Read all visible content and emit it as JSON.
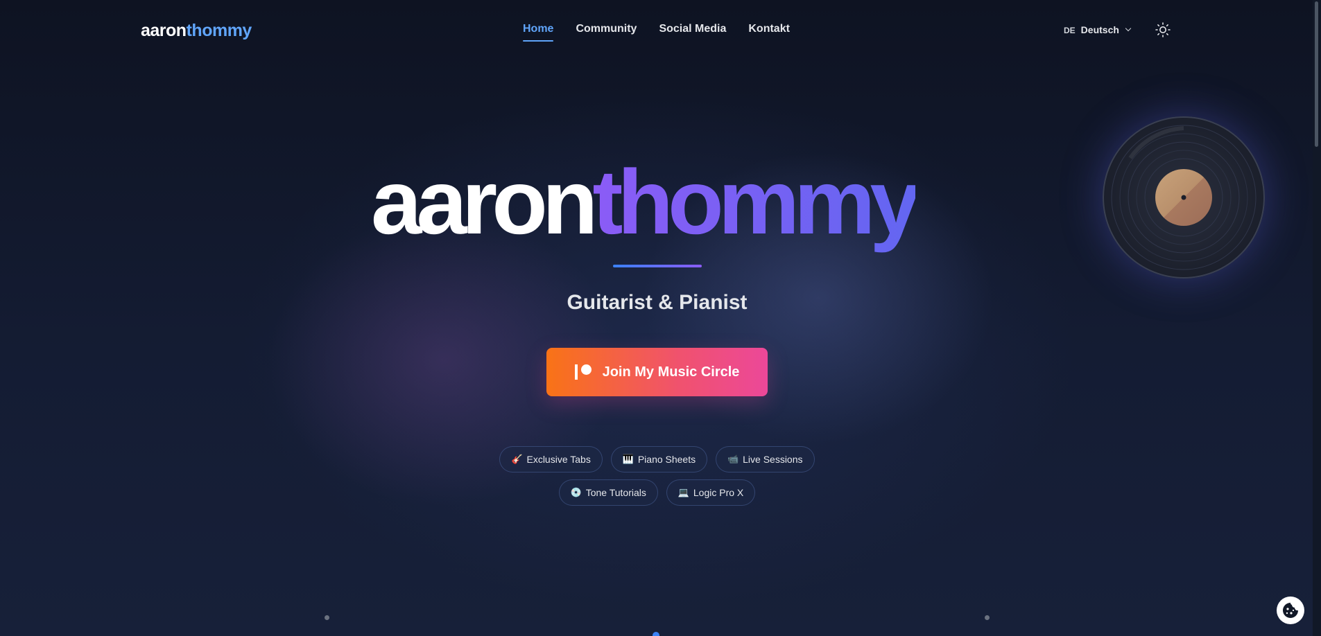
{
  "nav": {
    "logo_part1": "aaron",
    "logo_part2": "thommy",
    "links": [
      {
        "label": "Home",
        "active": true
      },
      {
        "label": "Community",
        "active": false
      },
      {
        "label": "Social Media",
        "active": false
      },
      {
        "label": "Kontakt",
        "active": false
      }
    ],
    "language": {
      "code": "DE",
      "name": "Deutsch"
    },
    "theme_icon": "sun-icon"
  },
  "hero": {
    "title_part1": "aaron",
    "title_part2": "thommy",
    "subtitle": "Guitarist & Pianist",
    "cta_label": "Join My Music Circle",
    "cta_icon": "patreon-icon"
  },
  "chips": [
    {
      "icon": "guitar-icon",
      "glyph": "🎸",
      "label": "Exclusive Tabs"
    },
    {
      "icon": "piano-icon",
      "glyph": "🎹",
      "label": "Piano Sheets"
    },
    {
      "icon": "camera-icon",
      "glyph": "📹",
      "label": "Live Sessions"
    },
    {
      "icon": "disc-icon",
      "glyph": "💿",
      "label": "Tone Tutorials"
    },
    {
      "icon": "laptop-icon",
      "glyph": "💻",
      "label": "Logic Pro X"
    }
  ],
  "decor": {
    "record_icon": "vinyl-record-icon",
    "cookie_icon": "cookie-icon"
  },
  "colors": {
    "accent_blue": "#60a5fa",
    "accent_purple": "#8b5cf6",
    "cta_start": "#f97316",
    "cta_end": "#ec4899",
    "background": "#0f1424"
  }
}
